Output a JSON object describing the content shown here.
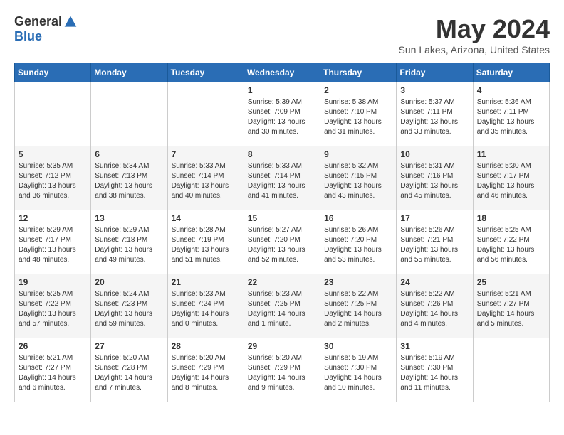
{
  "logo": {
    "general": "General",
    "blue": "Blue"
  },
  "title": {
    "month": "May 2024",
    "location": "Sun Lakes, Arizona, United States"
  },
  "weekdays": [
    "Sunday",
    "Monday",
    "Tuesday",
    "Wednesday",
    "Thursday",
    "Friday",
    "Saturday"
  ],
  "weeks": [
    [
      {
        "day": "",
        "info": ""
      },
      {
        "day": "",
        "info": ""
      },
      {
        "day": "",
        "info": ""
      },
      {
        "day": "1",
        "info": "Sunrise: 5:39 AM\nSunset: 7:09 PM\nDaylight: 13 hours\nand 30 minutes."
      },
      {
        "day": "2",
        "info": "Sunrise: 5:38 AM\nSunset: 7:10 PM\nDaylight: 13 hours\nand 31 minutes."
      },
      {
        "day": "3",
        "info": "Sunrise: 5:37 AM\nSunset: 7:11 PM\nDaylight: 13 hours\nand 33 minutes."
      },
      {
        "day": "4",
        "info": "Sunrise: 5:36 AM\nSunset: 7:11 PM\nDaylight: 13 hours\nand 35 minutes."
      }
    ],
    [
      {
        "day": "5",
        "info": "Sunrise: 5:35 AM\nSunset: 7:12 PM\nDaylight: 13 hours\nand 36 minutes."
      },
      {
        "day": "6",
        "info": "Sunrise: 5:34 AM\nSunset: 7:13 PM\nDaylight: 13 hours\nand 38 minutes."
      },
      {
        "day": "7",
        "info": "Sunrise: 5:33 AM\nSunset: 7:14 PM\nDaylight: 13 hours\nand 40 minutes."
      },
      {
        "day": "8",
        "info": "Sunrise: 5:33 AM\nSunset: 7:14 PM\nDaylight: 13 hours\nand 41 minutes."
      },
      {
        "day": "9",
        "info": "Sunrise: 5:32 AM\nSunset: 7:15 PM\nDaylight: 13 hours\nand 43 minutes."
      },
      {
        "day": "10",
        "info": "Sunrise: 5:31 AM\nSunset: 7:16 PM\nDaylight: 13 hours\nand 45 minutes."
      },
      {
        "day": "11",
        "info": "Sunrise: 5:30 AM\nSunset: 7:17 PM\nDaylight: 13 hours\nand 46 minutes."
      }
    ],
    [
      {
        "day": "12",
        "info": "Sunrise: 5:29 AM\nSunset: 7:17 PM\nDaylight: 13 hours\nand 48 minutes."
      },
      {
        "day": "13",
        "info": "Sunrise: 5:29 AM\nSunset: 7:18 PM\nDaylight: 13 hours\nand 49 minutes."
      },
      {
        "day": "14",
        "info": "Sunrise: 5:28 AM\nSunset: 7:19 PM\nDaylight: 13 hours\nand 51 minutes."
      },
      {
        "day": "15",
        "info": "Sunrise: 5:27 AM\nSunset: 7:20 PM\nDaylight: 13 hours\nand 52 minutes."
      },
      {
        "day": "16",
        "info": "Sunrise: 5:26 AM\nSunset: 7:20 PM\nDaylight: 13 hours\nand 53 minutes."
      },
      {
        "day": "17",
        "info": "Sunrise: 5:26 AM\nSunset: 7:21 PM\nDaylight: 13 hours\nand 55 minutes."
      },
      {
        "day": "18",
        "info": "Sunrise: 5:25 AM\nSunset: 7:22 PM\nDaylight: 13 hours\nand 56 minutes."
      }
    ],
    [
      {
        "day": "19",
        "info": "Sunrise: 5:25 AM\nSunset: 7:22 PM\nDaylight: 13 hours\nand 57 minutes."
      },
      {
        "day": "20",
        "info": "Sunrise: 5:24 AM\nSunset: 7:23 PM\nDaylight: 13 hours\nand 59 minutes."
      },
      {
        "day": "21",
        "info": "Sunrise: 5:23 AM\nSunset: 7:24 PM\nDaylight: 14 hours\nand 0 minutes."
      },
      {
        "day": "22",
        "info": "Sunrise: 5:23 AM\nSunset: 7:25 PM\nDaylight: 14 hours\nand 1 minute."
      },
      {
        "day": "23",
        "info": "Sunrise: 5:22 AM\nSunset: 7:25 PM\nDaylight: 14 hours\nand 2 minutes."
      },
      {
        "day": "24",
        "info": "Sunrise: 5:22 AM\nSunset: 7:26 PM\nDaylight: 14 hours\nand 4 minutes."
      },
      {
        "day": "25",
        "info": "Sunrise: 5:21 AM\nSunset: 7:27 PM\nDaylight: 14 hours\nand 5 minutes."
      }
    ],
    [
      {
        "day": "26",
        "info": "Sunrise: 5:21 AM\nSunset: 7:27 PM\nDaylight: 14 hours\nand 6 minutes."
      },
      {
        "day": "27",
        "info": "Sunrise: 5:20 AM\nSunset: 7:28 PM\nDaylight: 14 hours\nand 7 minutes."
      },
      {
        "day": "28",
        "info": "Sunrise: 5:20 AM\nSunset: 7:29 PM\nDaylight: 14 hours\nand 8 minutes."
      },
      {
        "day": "29",
        "info": "Sunrise: 5:20 AM\nSunset: 7:29 PM\nDaylight: 14 hours\nand 9 minutes."
      },
      {
        "day": "30",
        "info": "Sunrise: 5:19 AM\nSunset: 7:30 PM\nDaylight: 14 hours\nand 10 minutes."
      },
      {
        "day": "31",
        "info": "Sunrise: 5:19 AM\nSunset: 7:30 PM\nDaylight: 14 hours\nand 11 minutes."
      },
      {
        "day": "",
        "info": ""
      }
    ]
  ]
}
